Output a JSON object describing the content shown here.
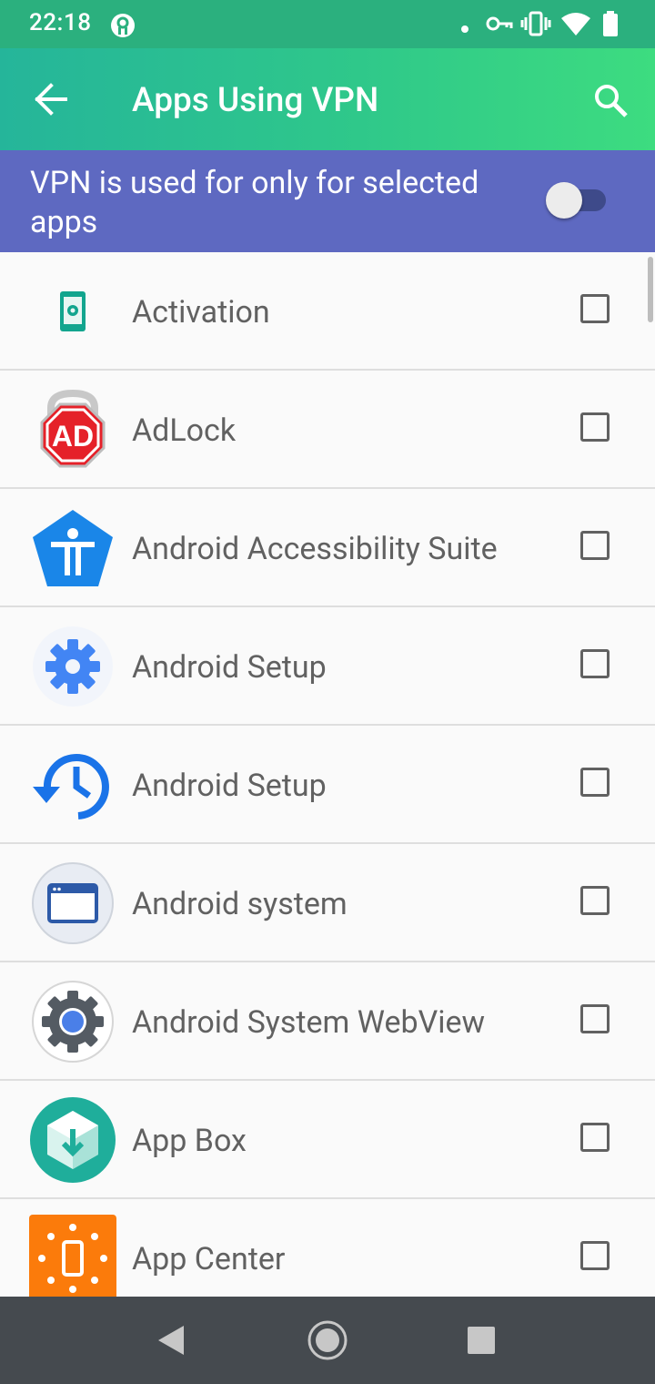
{
  "status_bar": {
    "time": "22:18",
    "left_icon": "vpn-key-circle-icon",
    "right_icons": [
      "dot-icon",
      "vpn-key-icon",
      "vibrate-icon",
      "wifi-icon",
      "battery-icon"
    ]
  },
  "toolbar": {
    "title": "Apps Using VPN",
    "back_icon": "arrow-back-icon",
    "search_icon": "search-icon"
  },
  "banner": {
    "text": "VPN is used for only for selected apps",
    "toggle_on": false
  },
  "apps": [
    {
      "name": "Activation",
      "icon": "activation-icon",
      "checked": false
    },
    {
      "name": "AdLock",
      "icon": "adlock-icon",
      "checked": false
    },
    {
      "name": "Android Accessibility Suite",
      "icon": "accessibility-icon",
      "checked": false
    },
    {
      "name": "Android Setup",
      "icon": "setup-gear-icon",
      "checked": false
    },
    {
      "name": "Android Setup",
      "icon": "setup-restore-icon",
      "checked": false
    },
    {
      "name": "Android system",
      "icon": "android-system-icon",
      "checked": false
    },
    {
      "name": "Android System WebView",
      "icon": "webview-icon",
      "checked": false
    },
    {
      "name": "App Box",
      "icon": "app-box-icon",
      "checked": false
    },
    {
      "name": "App Center",
      "icon": "app-center-icon",
      "checked": false
    }
  ],
  "nav_bar": {
    "buttons": [
      "back-triangle-icon",
      "home-circle-icon",
      "recents-square-icon"
    ]
  },
  "colors": {
    "status_bar": "#2bb07e",
    "toolbar_start": "#25b59a",
    "toolbar_end": "#3ddc80",
    "banner": "#5e69c1",
    "nav_bar": "#454a4f"
  }
}
